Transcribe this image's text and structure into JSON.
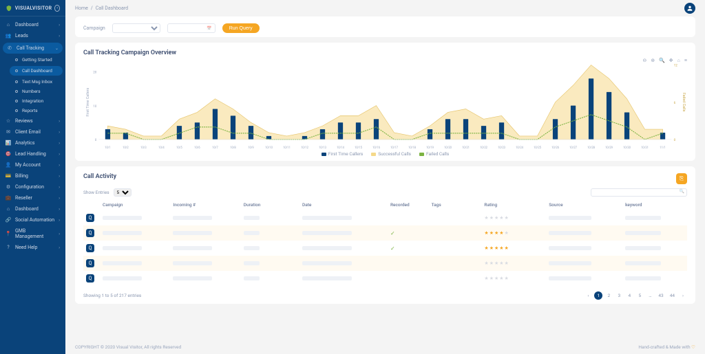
{
  "brand": "VISUALVISITOR",
  "breadcrumb": {
    "home": "Home",
    "current": "Call Dashboard"
  },
  "sidebar": {
    "items": [
      {
        "icon": "⌂",
        "label": "Dashboard"
      },
      {
        "icon": "👥",
        "label": "Leads"
      },
      {
        "icon": "✆",
        "label": "Call Tracking",
        "active": true,
        "expand": true,
        "children": [
          {
            "label": "Getting Started"
          },
          {
            "label": "Call Dashboard",
            "active": true
          },
          {
            "label": "Text Msg Inbox"
          },
          {
            "label": "Numbers"
          },
          {
            "label": "Integration"
          },
          {
            "label": "Reports"
          }
        ]
      },
      {
        "icon": "☆",
        "label": "Reviews"
      },
      {
        "icon": "✉",
        "label": "Client Email"
      },
      {
        "icon": "📊",
        "label": "Analytics"
      },
      {
        "icon": "🎯",
        "label": "Lead Handling"
      },
      {
        "icon": "👤",
        "label": "My Account"
      },
      {
        "icon": "💳",
        "label": "Billing"
      },
      {
        "icon": "⚙",
        "label": "Configuration"
      },
      {
        "icon": "💼",
        "label": "Reseller"
      },
      {
        "icon": "⌂",
        "label": "Dashboard"
      },
      {
        "icon": "🔗",
        "label": "Social Automation"
      },
      {
        "icon": "📍",
        "label": "GMB Management"
      },
      {
        "icon": "?",
        "label": "Need Help"
      }
    ]
  },
  "toolbar": {
    "campaign_label": "Campaign",
    "run_label": "Run Query"
  },
  "overview_title": "Call Tracking Campaign Overview",
  "chart_data": {
    "type": "bar",
    "categories": [
      "10/1",
      "10/2",
      "10/3",
      "10/4",
      "10/5",
      "10/6",
      "10/7",
      "10/8",
      "10/9",
      "10/10",
      "10/11",
      "10/12",
      "10/13",
      "10/14",
      "10/15",
      "10/16",
      "10/17",
      "10/18",
      "10/19",
      "10/20",
      "10/21",
      "10/22",
      "10/23",
      "10/24",
      "10/25",
      "10/26",
      "10/27",
      "10/28",
      "10/29",
      "10/30",
      "10/31",
      "11/1"
    ],
    "series": [
      {
        "name": "First Time Callers",
        "type": "bar",
        "color": "#0a437a",
        "values": [
          3,
          2,
          0,
          0,
          4,
          5,
          9,
          7,
          4,
          1,
          0,
          1,
          3,
          5,
          5,
          6,
          0,
          0,
          3,
          6,
          6,
          4,
          5,
          0,
          0,
          6,
          10,
          18,
          14,
          8,
          0,
          2
        ]
      },
      {
        "name": "Successful Calls",
        "type": "area",
        "color": "#f5d98a",
        "values": [
          4,
          3,
          1,
          1,
          6,
          8,
          12,
          9,
          5,
          2,
          1,
          2,
          4,
          7,
          7,
          10,
          2,
          1,
          4,
          8,
          9,
          6,
          7,
          1,
          1,
          11,
          16,
          22,
          18,
          12,
          3,
          3
        ]
      },
      {
        "name": "Failed Calls",
        "type": "line",
        "color": "#7cb342",
        "values": [
          1,
          1,
          0,
          0,
          1,
          2,
          2,
          1,
          1,
          0,
          0,
          0,
          1,
          1,
          1,
          2,
          0,
          0,
          1,
          1,
          1,
          1,
          1,
          0,
          0,
          2,
          3,
          4,
          3,
          2,
          0,
          1
        ]
      }
    ],
    "ylabel_left": "First Time Callers",
    "ylabel_right": "Failed Calls",
    "ylim": [
      0,
      22
    ],
    "right_ticks": [
      0,
      6,
      12
    ]
  },
  "activity": {
    "title": "Call Activity",
    "show_label": "Show Entries",
    "show_value": "5",
    "columns": [
      "Campaign",
      "Incoming #",
      "Duration",
      "Date",
      "Recorded",
      "Tags",
      "Rating",
      "Source",
      "keyword"
    ],
    "rows": [
      {
        "recorded": false,
        "rating": 0
      },
      {
        "recorded": true,
        "rating": 4
      },
      {
        "recorded": true,
        "rating": 5
      },
      {
        "recorded": false,
        "rating": 0
      },
      {
        "recorded": false,
        "rating": 0
      }
    ],
    "footer_text": "Showing 1 to 5 of 217 entries",
    "pages": [
      "1",
      "2",
      "3",
      "4",
      "5",
      "…",
      "43",
      "44"
    ]
  },
  "footer": {
    "copyright": "COPYRIGHT © 2020 Visual Visitor, All rights Reserved",
    "credit": "Hand-crafted & Made with"
  }
}
